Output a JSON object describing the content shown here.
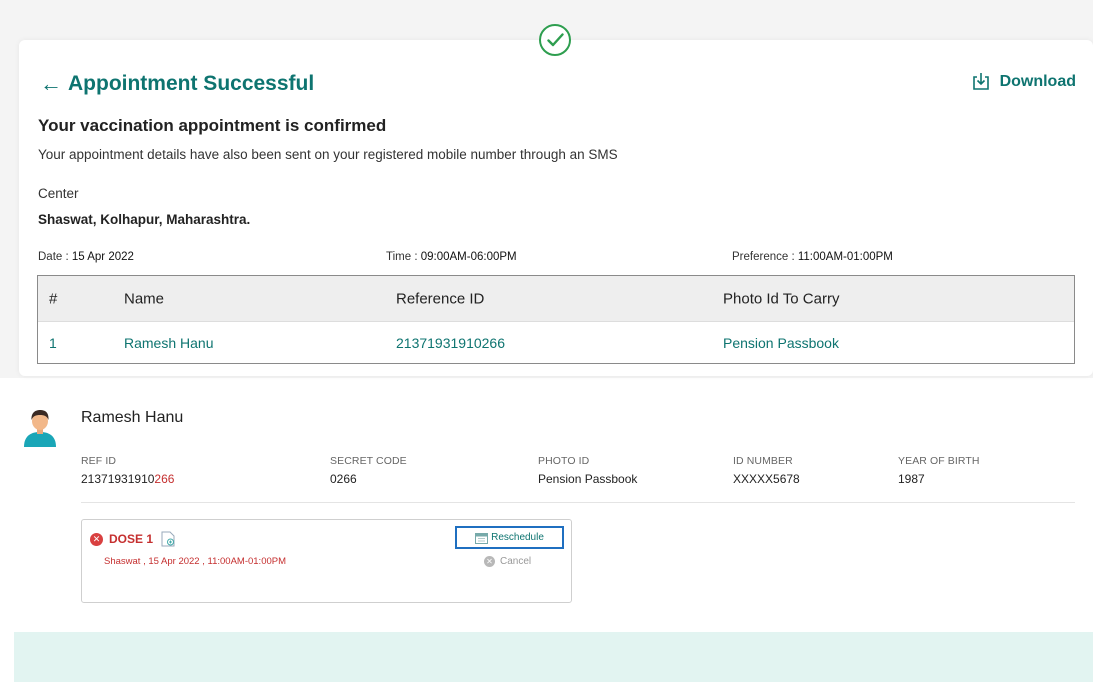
{
  "header": {
    "title": "Appointment Successful",
    "back_icon": "arrow-left-icon",
    "download_label": "Download",
    "download_icon": "download-icon",
    "success_icon": "check-circle-icon"
  },
  "confirmation": {
    "heading": "Your vaccination appointment is confirmed",
    "subtext": "Your appointment details have also been sent on your registered mobile number through an SMS",
    "center_label": "Center",
    "center_value": "Shaswat, Kolhapur, Maharashtra."
  },
  "schedule": {
    "date_label": "Date : ",
    "date_value": "15 Apr 2022",
    "time_label": "Time : ",
    "time_value": "09:00AM-06:00PM",
    "preference_label": "Preference : ",
    "preference_value": "11:00AM-01:00PM"
  },
  "table": {
    "headers": [
      "#",
      "Name",
      "Reference ID",
      "Photo Id To Carry"
    ],
    "rows": [
      [
        "1",
        "Ramesh Hanu",
        "21371931910266",
        "Pension Passbook"
      ]
    ]
  },
  "beneficiary": {
    "name": "Ramesh Hanu",
    "ref_id_label": "REF ID",
    "ref_id_prefix": "21371931910",
    "ref_id_suffix": "266",
    "secret_code_label": "SECRET CODE",
    "secret_code": "0266",
    "photo_id_label": "PHOTO ID",
    "photo_id": "Pension Passbook",
    "id_number_label": "ID NUMBER",
    "id_number": "XXXXX5678",
    "yob_label": "YEAR OF BIRTH",
    "yob": "1987"
  },
  "dose": {
    "title": "DOSE 1",
    "detail": "Shaswat , 15 Apr 2022 , 11:00AM-01:00PM",
    "reschedule_label": "Reschedule",
    "cancel_label": "Cancel"
  },
  "colors": {
    "primary": "#0e7470",
    "success": "#2e9e4f",
    "danger": "#c52f2f",
    "highlight": "#1f6fc0"
  }
}
